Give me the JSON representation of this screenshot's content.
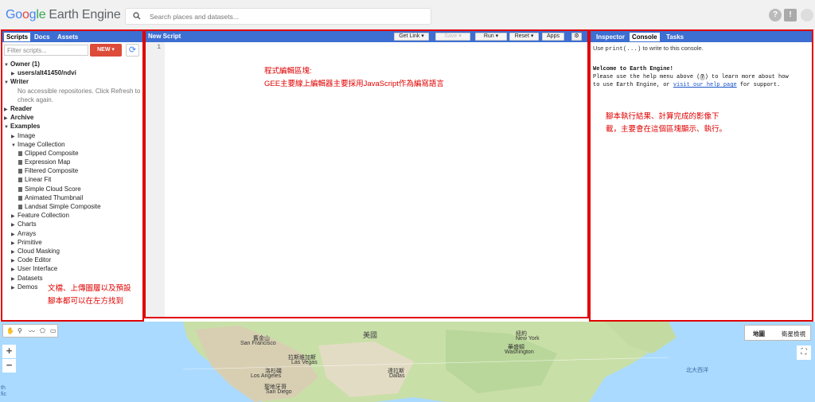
{
  "header": {
    "logo_g": "Go",
    "logo_o": "o",
    "logo_gl": "g",
    "logo_le": "le",
    "product": "Earth Engine",
    "search_placeholder": "Search places and datasets..."
  },
  "left_panel": {
    "tabs": [
      "Scripts",
      "Docs",
      "Assets"
    ],
    "filter_placeholder": "Filter scripts...",
    "new_button": "NEW",
    "tree": [
      {
        "label": "Owner (1)",
        "level": 0,
        "arrow": "open",
        "bold": true
      },
      {
        "label": "users/alt41450/ndvi",
        "level": 1,
        "arrow": "closed",
        "bold": true
      },
      {
        "label": "Writer",
        "level": 0,
        "arrow": "open",
        "bold": true
      },
      {
        "label": "No accessible repositories. Click Refresh to",
        "level": 1,
        "arrow": "none",
        "grey": true
      },
      {
        "label": "check again.",
        "level": 1,
        "arrow": "none",
        "grey": true
      },
      {
        "label": "Reader",
        "level": 0,
        "arrow": "closed",
        "bold": true
      },
      {
        "label": "Archive",
        "level": 0,
        "arrow": "closed",
        "bold": true
      },
      {
        "label": "Examples",
        "level": 0,
        "arrow": "open",
        "bold": true
      },
      {
        "label": "Image",
        "level": 1,
        "arrow": "closed"
      },
      {
        "label": "Image Collection",
        "level": 1,
        "arrow": "open"
      },
      {
        "label": "Clipped Composite",
        "level": 2,
        "arrow": "doc"
      },
      {
        "label": "Expression Map",
        "level": 2,
        "arrow": "doc"
      },
      {
        "label": "Filtered Composite",
        "level": 2,
        "arrow": "doc"
      },
      {
        "label": "Linear Fit",
        "level": 2,
        "arrow": "doc"
      },
      {
        "label": "Simple Cloud Score",
        "level": 2,
        "arrow": "doc"
      },
      {
        "label": "Animated Thumbnail",
        "level": 2,
        "arrow": "doc"
      },
      {
        "label": "Landsat Simple Composite",
        "level": 2,
        "arrow": "doc"
      },
      {
        "label": "Feature Collection",
        "level": 1,
        "arrow": "closed"
      },
      {
        "label": "Charts",
        "level": 1,
        "arrow": "closed"
      },
      {
        "label": "Arrays",
        "level": 1,
        "arrow": "closed"
      },
      {
        "label": "Primitive",
        "level": 1,
        "arrow": "closed"
      },
      {
        "label": "Cloud Masking",
        "level": 1,
        "arrow": "closed"
      },
      {
        "label": "Code Editor",
        "level": 1,
        "arrow": "closed"
      },
      {
        "label": "User Interface",
        "level": 1,
        "arrow": "closed"
      },
      {
        "label": "Datasets",
        "level": 1,
        "arrow": "closed"
      },
      {
        "label": "Demos",
        "level": 1,
        "arrow": "closed"
      }
    ],
    "annotation_1": "文檔、上傳圖層以及預設",
    "annotation_2": "腳本都可以在左方找到"
  },
  "editor": {
    "title": "New Script",
    "get_link": "Get Link",
    "save": "Save",
    "run": "Run",
    "reset": "Reset",
    "apps": "Apps",
    "line_number": "1",
    "annotation_1": "程式編輯區塊:",
    "annotation_2": "GEE主要線上編輯器主要採用JavaScript作為編寫語言"
  },
  "right_panel": {
    "tabs": [
      "Inspector",
      "Console",
      "Tasks"
    ],
    "hint_pre": "Use ",
    "hint_code": "print(...)",
    "hint_post": " to write to this console.",
    "welcome_title": "Welcome to Earth Engine!",
    "welcome_line1": "Please use the help menu above (",
    "welcome_q": "?",
    "welcome_line1b": ") to learn more about how",
    "welcome_line2": "to use Earth Engine, or ",
    "welcome_link": "visit our help page",
    "welcome_line2b": " for support.",
    "annotation_1": "腳本執行結果、計算完成的影像下",
    "annotation_2": "載，主要會在這個區塊顯示、執行。"
  },
  "map": {
    "map_button": "地圖",
    "satellite_button": "衛星檢視",
    "zoom_in": "+",
    "zoom_out": "−",
    "labels": {
      "usa": "美國",
      "san_francisco_zh": "舊金山",
      "san_francisco": "San Francisco",
      "las_vegas_zh": "拉斯維加斯",
      "las_vegas": "Las Vegas",
      "los_angeles_zh": "洛杉磯",
      "los_angeles": "Los Angeles",
      "san_diego_zh": "聖地牙哥",
      "san_diego": "San Diego",
      "new_york_zh": "紐約",
      "new_york": "New York",
      "washington_zh": "華盛頓",
      "washington": "Washington",
      "dallas_zh": "達拉斯",
      "dallas": "Dallas",
      "atlantic": "北大西洋",
      "pacific_frag": "th\nfic"
    }
  },
  "colors": {
    "blue_header": "#3d6ed1",
    "annotation_red": "#e00000",
    "new_button": "#dd4b39"
  }
}
